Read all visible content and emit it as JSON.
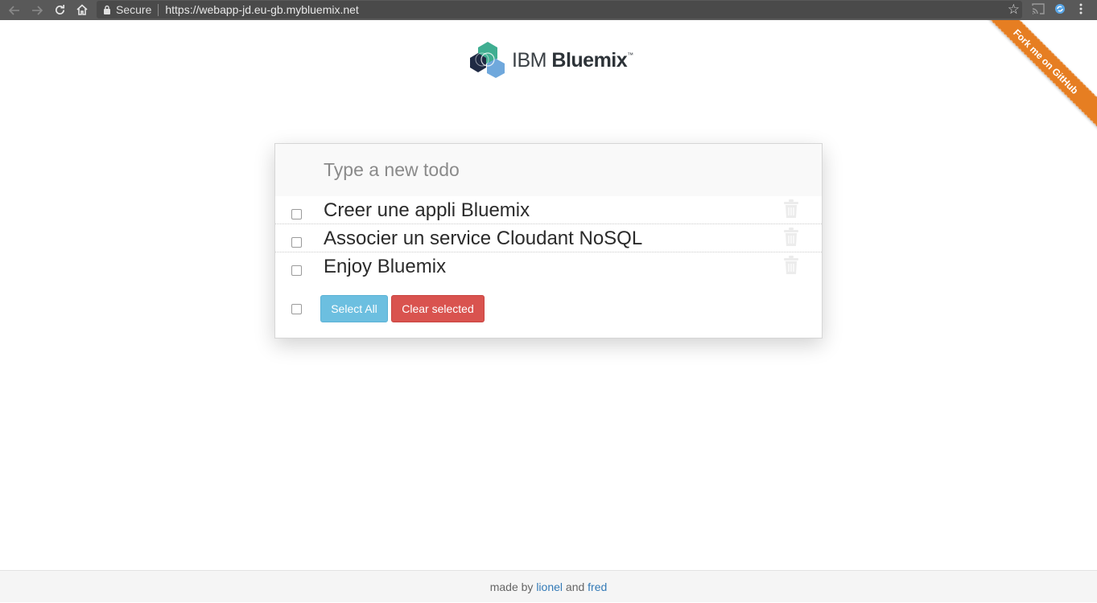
{
  "browser": {
    "secure_label": "Secure",
    "url": "https://webapp-jd.eu-gb.mybluemix.net",
    "back_icon": "arrow-left-icon",
    "forward_icon": "arrow-right-icon",
    "reload_icon": "reload-icon",
    "home_icon": "home-icon",
    "star_icon": "star-icon",
    "menu_icon": "kebab-menu-icon"
  },
  "logo": {
    "brand": "IBM",
    "product": "Bluemix",
    "tm": "™"
  },
  "ribbon": {
    "label": "Fork me on GitHub"
  },
  "todo": {
    "placeholder": "Type a new todo",
    "items": [
      {
        "text": "Creer une appli Bluemix",
        "checked": false
      },
      {
        "text": "Associer un service Cloudant NoSQL",
        "checked": false
      },
      {
        "text": "Enjoy Bluemix",
        "checked": false
      }
    ],
    "select_all_label": "Select All",
    "clear_label": "Clear selected"
  },
  "footer": {
    "made_by": "made by",
    "author1": "lionel",
    "and": "and",
    "author2": "fred"
  },
  "colors": {
    "ribbon": "#e67e22",
    "select_button": "#6cbfe0",
    "clear_button": "#d9534f",
    "link": "#337ab7"
  }
}
